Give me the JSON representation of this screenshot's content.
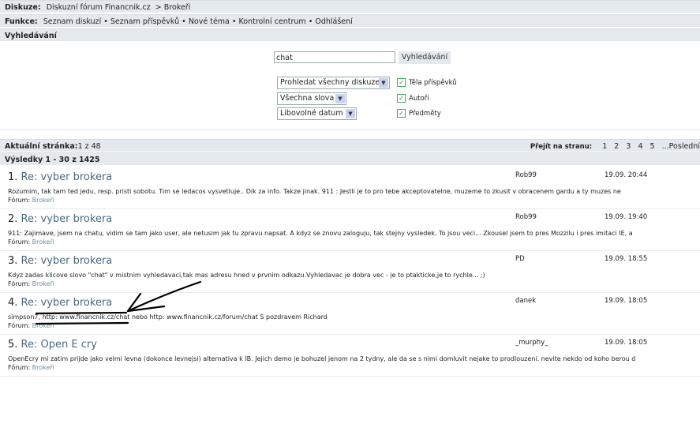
{
  "breadcrumb": {
    "label": "Diskuze:",
    "forum": "Diskuzní fórum Financnik.cz",
    "sep": ">",
    "section": "Brokeři"
  },
  "functions": {
    "label": "Funkce:",
    "items": [
      "Seznam diskuzí",
      "Seznam příspěvků",
      "Nové téma",
      "Kontrolní centrum",
      "Odhlášení"
    ],
    "sep": "•"
  },
  "search": {
    "title": "Vyhledávání",
    "query": "chat",
    "button": "Vyhledávání",
    "scope": "Prohledat všechny diskuze",
    "words": "Všechna slova",
    "date": "Libovolné datum",
    "checks": [
      {
        "label": "Těla příspěvků",
        "checked": true
      },
      {
        "label": "Autoři",
        "checked": true
      },
      {
        "label": "Předměty",
        "checked": true
      }
    ]
  },
  "paging": {
    "label": "Aktuální stránka:",
    "value": "1 z 48",
    "goto": "Přejít na stranu:",
    "pages": [
      "1",
      "2",
      "3",
      "4",
      "5"
    ],
    "last": "...Poslední"
  },
  "results_header": "Výsledky 1 - 30 z 1425",
  "forum_label": "Fórum:",
  "results": [
    {
      "num": "1.",
      "title": "Re: vyber brokera",
      "author": "Rob99",
      "date": "19.09. 20:44",
      "text": "Rozumim, tak tam ted jedu, resp. pristi sobotu. Tim se ledacos vysvetluje.. Dik za info. Takze jinak. 911 : Jestli je to pro tebe akceptovatelne, muzeme to zkusit v obracenem gardu a ty muzes ne",
      "forum": "Brokeři"
    },
    {
      "num": "2.",
      "title": "Re: vyber brokera",
      "author": "Rob99",
      "date": "19.09. 19:40",
      "text": "911: Zajimave, jsem na chatu, vidim se tam jako user, ale netusim jak tu zpravu napsat. A kdyz se znovu zaloguju, tak stejny vysledek. To jsou veci... Zkousel jsem to pres Mozzilu i pres imitaci IE, a",
      "forum": "Brokeři"
    },
    {
      "num": "3.",
      "title": "Re: vyber brokera",
      "author": "PD",
      "date": "19.09. 18:55",
      "text": "Kdyz zadas klicove slovo \"chat\" v mistnim vyhledavaci,tak mas adresu hned v prvnim odkazu.Vyhledavac je dobra vec - je to ptakticke,je to rychle... ;)",
      "forum": "Brokeři"
    },
    {
      "num": "4.",
      "title": "Re: vyber brokera",
      "author": "danek",
      "date": "19.09. 18:05",
      "text": "simpson7, http: www.financnik.cz/chat nebo http: www.financnik.cz/forum/chat S pozdravem Richard",
      "forum": "Brokeři"
    },
    {
      "num": "5.",
      "title": "Re: Open E cry",
      "author": "_murphy_",
      "date": "19.09. 18:05",
      "text": "OpenEcry mi zatim prijde jako velmi levna (dokonce levnejsi) alternativa k IB. Jejich demo je bohuzel jenom na 2 tydny, ale da se s nimi domluvit nejake to prodlouzeni. nevite nekdo od koho berou d",
      "forum": "Brokeři"
    }
  ]
}
